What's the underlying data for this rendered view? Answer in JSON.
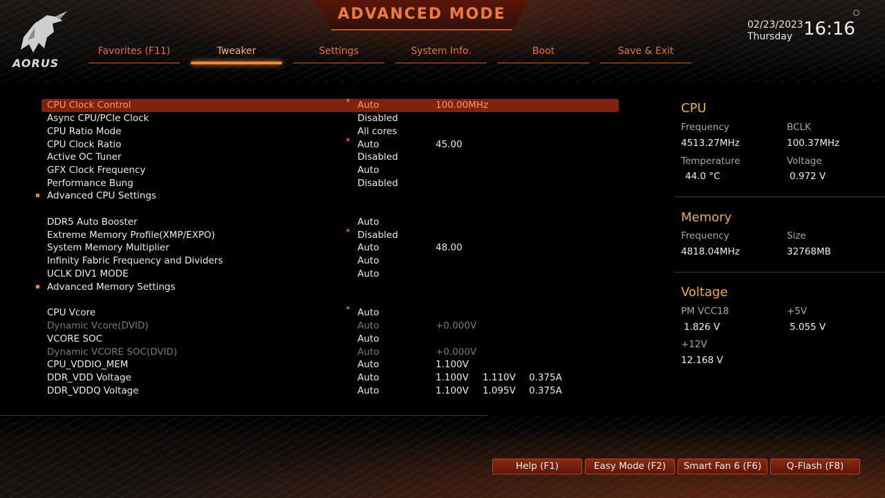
{
  "header": {
    "title": "ADVANCED MODE",
    "logo_text": "AORUS",
    "date": "02/23/2023",
    "weekday": "Thursday",
    "time": "16:16"
  },
  "tabs": [
    {
      "label": "Favorites (F11)"
    },
    {
      "label": "Tweaker"
    },
    {
      "label": "Settings"
    },
    {
      "label": "System Info."
    },
    {
      "label": "Boot"
    },
    {
      "label": "Save & Exit"
    }
  ],
  "settings": [
    {
      "label": "CPU Clock Control",
      "star": "*",
      "value": "Auto",
      "extra": "100.00MHz"
    },
    {
      "label": "Async CPU/PCIe Clock",
      "value": "Disabled"
    },
    {
      "label": "CPU Ratio Mode",
      "value": "All cores"
    },
    {
      "label": "CPU Clock Ratio",
      "star": "*",
      "value": "Auto",
      "extra": "45.00"
    },
    {
      "label": "Active OC Tuner",
      "value": "Disabled"
    },
    {
      "label": "GFX Clock Frequency",
      "value": "Auto"
    },
    {
      "label": "Performance Bung",
      "value": "Disabled"
    },
    {
      "label": "Advanced CPU Settings"
    },
    {
      "label": "DDR5 Auto Booster",
      "value": "Auto"
    },
    {
      "label": "Extreme Memory Profile(XMP/EXPO)",
      "star": "*",
      "value": "Disabled"
    },
    {
      "label": "System Memory Multiplier",
      "value": "Auto",
      "extra": "48.00"
    },
    {
      "label": "Infinity Fabric Frequency and Dividers",
      "value": "Auto"
    },
    {
      "label": "UCLK DIV1 MODE",
      "value": "Auto"
    },
    {
      "label": "Advanced Memory Settings"
    },
    {
      "label": "CPU Vcore",
      "star": "*",
      "value": "Auto"
    },
    {
      "label": "Dynamic Vcore(DVID)",
      "value": "Auto",
      "extra": "+0.000V"
    },
    {
      "label": "VCORE SOC",
      "value": "Auto"
    },
    {
      "label": "Dynamic VCORE SOC(DVID)",
      "value": "Auto",
      "extra": "+0.000V"
    },
    {
      "label": "CPU_VDDIO_MEM",
      "value": "Auto",
      "extra": "1.100V"
    },
    {
      "label": "DDR_VDD Voltage",
      "value": "Auto",
      "extra": "1.100V",
      "extra2": "1.110V",
      "extra3": "0.375A"
    },
    {
      "label": "DDR_VDDQ Voltage",
      "value": "Auto",
      "extra": "1.100V",
      "extra2": "1.095V",
      "extra3": "0.375A"
    }
  ],
  "cpu": {
    "title": "CPU",
    "freq_label": "Frequency",
    "freq": "4513.27MHz",
    "bclk_label": "BCLK",
    "bclk": "100.37MHz",
    "temp_label": "Temperature",
    "temp": "44.0 °C",
    "volt_label": "Voltage",
    "volt": "0.972 V"
  },
  "memory": {
    "title": "Memory",
    "freq_label": "Frequency",
    "freq": "4818.04MHz",
    "size_label": "Size",
    "size": "32768MB"
  },
  "voltage": {
    "title": "Voltage",
    "pm_label": "PM VCC18",
    "pm": "1.826 V",
    "v5_label": "+5V",
    "v5": "5.055 V",
    "v12_label": "+12V",
    "v12": "12.168 V"
  },
  "footer": {
    "help": "Help (F1)",
    "easy": "Easy Mode (F2)",
    "fan": "Smart Fan 6 (F6)",
    "qflash": "Q-Flash (F8)"
  },
  "colors": {
    "accent": "#e07436",
    "selected_row": "#7e2211",
    "panel_title": "#f0b030"
  }
}
